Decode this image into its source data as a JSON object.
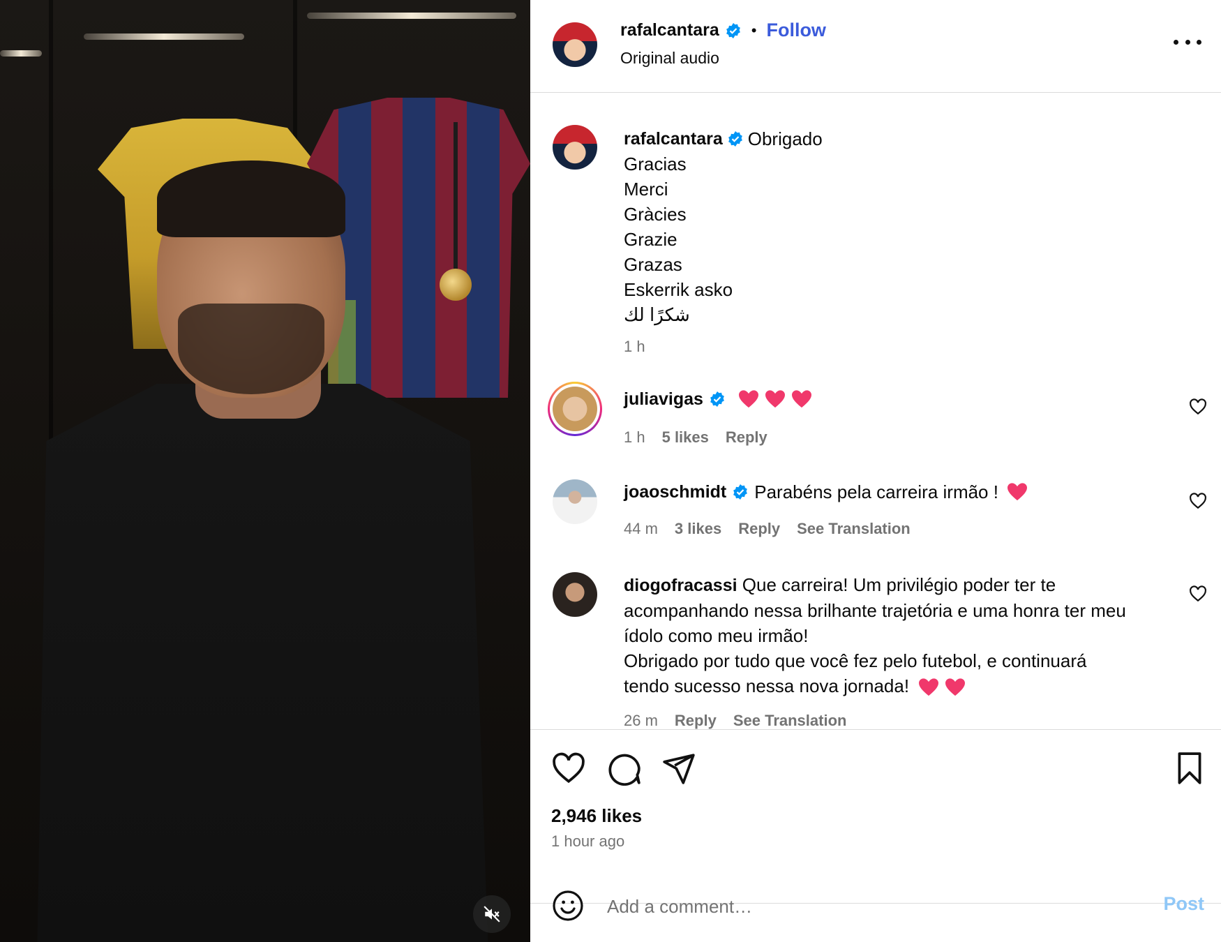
{
  "post": {
    "author": "rafalcantara",
    "follow_label": "Follow",
    "audio_label": "Original audio",
    "dot": "•"
  },
  "caption": {
    "username": "rafalcantara",
    "lines": [
      "Obrigado",
      "Gracias",
      "Merci",
      "Gràcies",
      "Grazie",
      "Grazas",
      "Eskerrik asko",
      "شكرًا لك"
    ],
    "time": "1 h"
  },
  "comments": [
    {
      "username": "juliavigas",
      "verified": true,
      "text": "",
      "time": "1 h",
      "likes": "5 likes",
      "reply": "Reply"
    },
    {
      "username": "joaoschmidt",
      "verified": true,
      "text": "Parabéns pela carreira irmão !",
      "time": "44 m",
      "likes": "3 likes",
      "reply": "Reply",
      "translation": "See Translation"
    },
    {
      "username": "diogofracassi",
      "verified": false,
      "text_lines": [
        "Que carreira! Um privilégio poder ter te",
        "acompanhando nessa brilhante trajetória e uma honra ter meu",
        "ídolo como meu irmão!",
        "Obrigado por tudo que você fez pelo futebol, e continuará",
        "tendo sucesso nessa nova jornada!"
      ],
      "time": "26 m",
      "reply": "Reply",
      "translation": "See Translation"
    }
  ],
  "actions": {
    "likes": "2,946 likes",
    "time_ago": "1 hour ago"
  },
  "compose": {
    "placeholder": "Add a comment…",
    "post_label": "Post"
  },
  "colors": {
    "accent": "#0095f6",
    "follow": "#3b5bdb",
    "muted": "#737373",
    "border": "#dbdbdb",
    "heart_emoji": "#f0386b"
  },
  "icons": [
    "more-options-icon",
    "verified-badge-icon",
    "heart-icon",
    "comment-icon",
    "share-icon",
    "bookmark-icon",
    "emoji-icon",
    "mute-icon"
  ]
}
